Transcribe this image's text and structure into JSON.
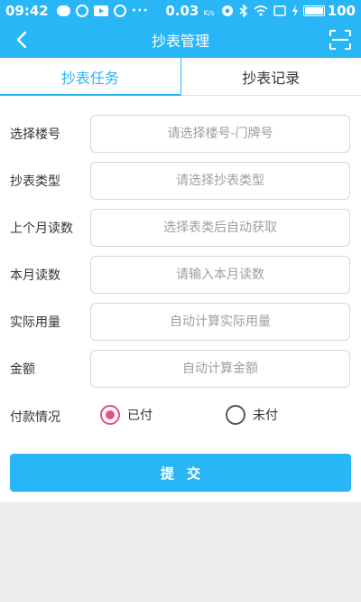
{
  "status_bar": {
    "time": "09:42",
    "speed": "0.03",
    "speed_unit": "K/s",
    "battery": "100",
    "dots": "···"
  },
  "header": {
    "title": "抄表管理",
    "back_icon": "chevron-left-icon",
    "scan_icon": "scan-icon"
  },
  "tabs": [
    {
      "label": "抄表任务",
      "active": true
    },
    {
      "label": "抄表记录",
      "active": false
    }
  ],
  "form": {
    "fields": [
      {
        "label": "选择楼号",
        "value": "",
        "placeholder": "请选择楼号-门牌号"
      },
      {
        "label": "抄表类型",
        "value": "",
        "placeholder": "请选择抄表类型"
      },
      {
        "label": "上个月读数",
        "value": "",
        "placeholder": "选择表类后自动获取"
      },
      {
        "label": "本月读数",
        "value": "",
        "placeholder": "请输入本月读数"
      },
      {
        "label": "实际用量",
        "value": "",
        "placeholder": "自动计算实际用量"
      },
      {
        "label": "金额",
        "value": "",
        "placeholder": "自动计算金额"
      }
    ],
    "payment": {
      "label": "付款情况",
      "options": [
        {
          "label": "已付",
          "checked": true
        },
        {
          "label": "未付",
          "checked": false
        }
      ]
    },
    "submit_label": "提交"
  },
  "colors": {
    "primary": "#29b6f6",
    "radio_checked": "#e84e7a",
    "background": "#eeeeee"
  }
}
